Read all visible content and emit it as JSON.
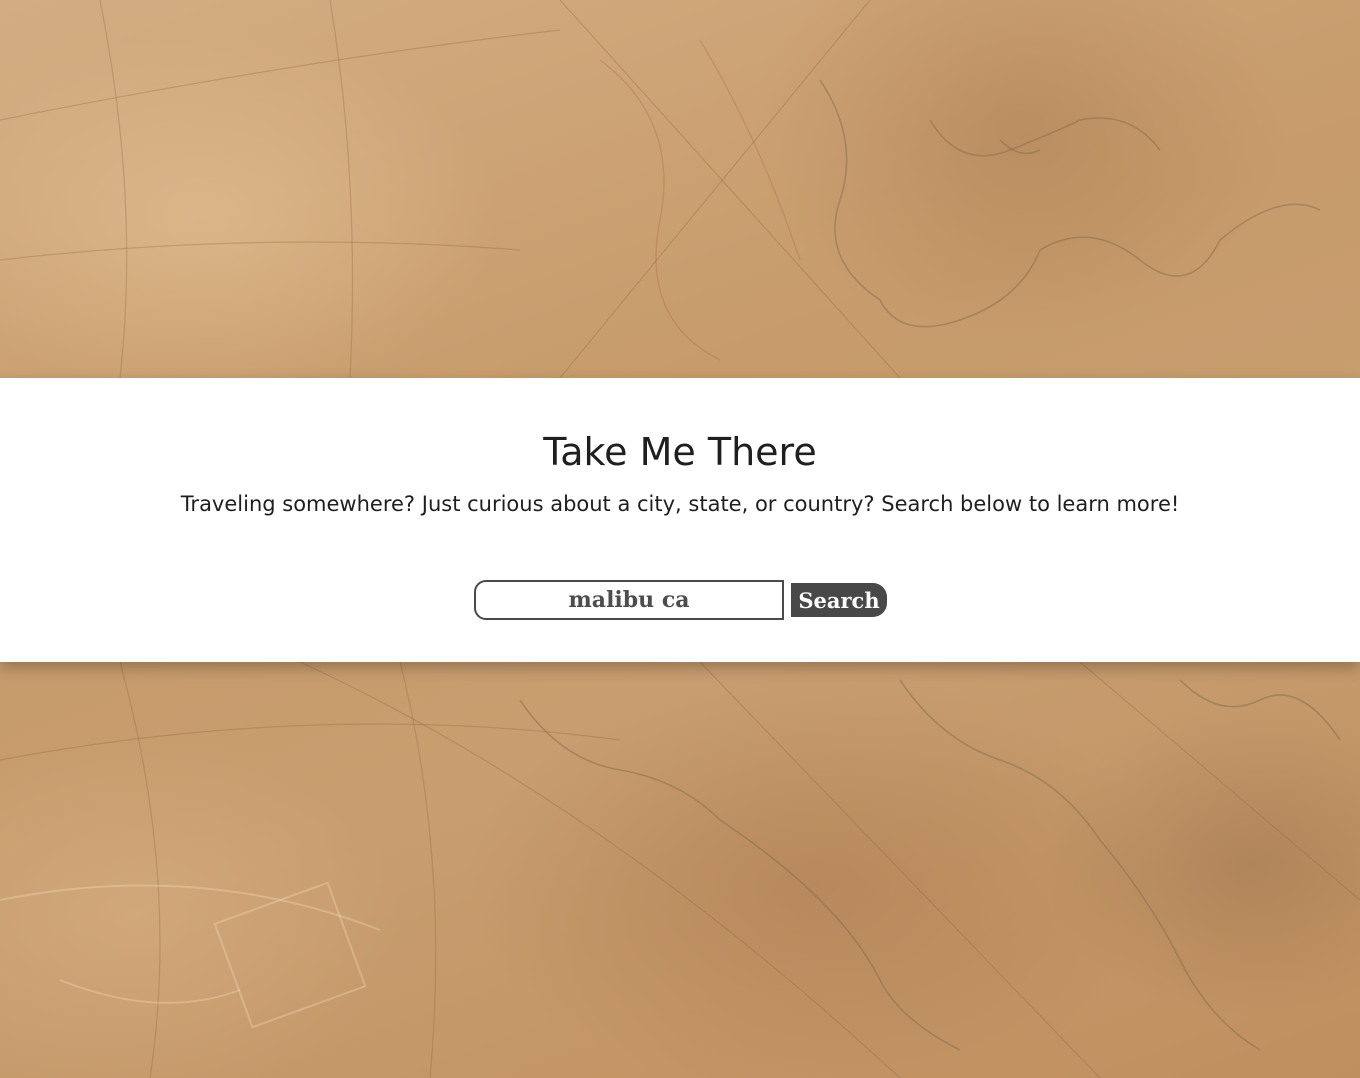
{
  "page": {
    "title": "Take Me There",
    "subtitle": "Traveling somewhere? Just curious about a city, state, or country? Search below to learn more!"
  },
  "search": {
    "value": "malibu ca",
    "button_label": "Search"
  },
  "background": {
    "icon": "antique-map-background",
    "color": "#c9a174"
  },
  "colors": {
    "banner": "#ffffff",
    "text": "#1f1f1f",
    "button": "#484848",
    "button_text": "#ffffff"
  }
}
